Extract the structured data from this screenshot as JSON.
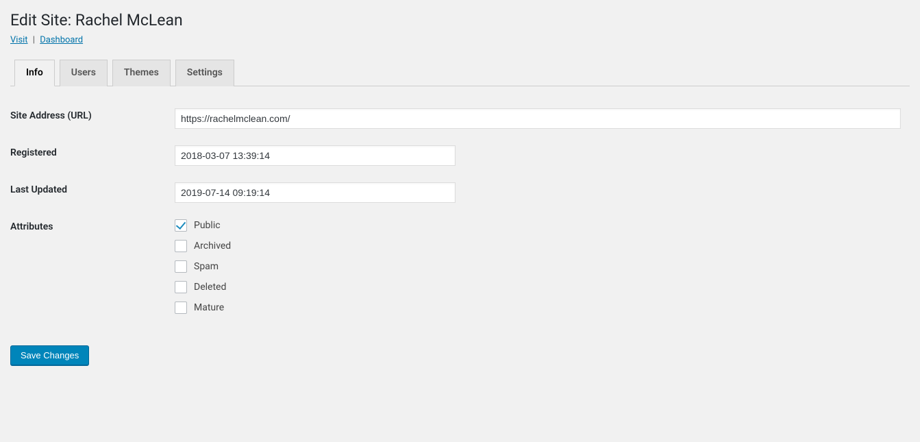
{
  "header": {
    "title": "Edit Site: Rachel McLean",
    "visit_link": "Visit",
    "dashboard_link": "Dashboard"
  },
  "tabs": [
    {
      "label": "Info",
      "active": true
    },
    {
      "label": "Users",
      "active": false
    },
    {
      "label": "Themes",
      "active": false
    },
    {
      "label": "Settings",
      "active": false
    }
  ],
  "form": {
    "site_address_label": "Site Address (URL)",
    "site_address_value": "https://rachelmclean.com/",
    "registered_label": "Registered",
    "registered_value": "2018-03-07 13:39:14",
    "last_updated_label": "Last Updated",
    "last_updated_value": "2019-07-14 09:19:14",
    "attributes_label": "Attributes",
    "attributes": [
      {
        "label": "Public",
        "checked": true
      },
      {
        "label": "Archived",
        "checked": false
      },
      {
        "label": "Spam",
        "checked": false
      },
      {
        "label": "Deleted",
        "checked": false
      },
      {
        "label": "Mature",
        "checked": false
      }
    ],
    "save_button": "Save Changes"
  }
}
